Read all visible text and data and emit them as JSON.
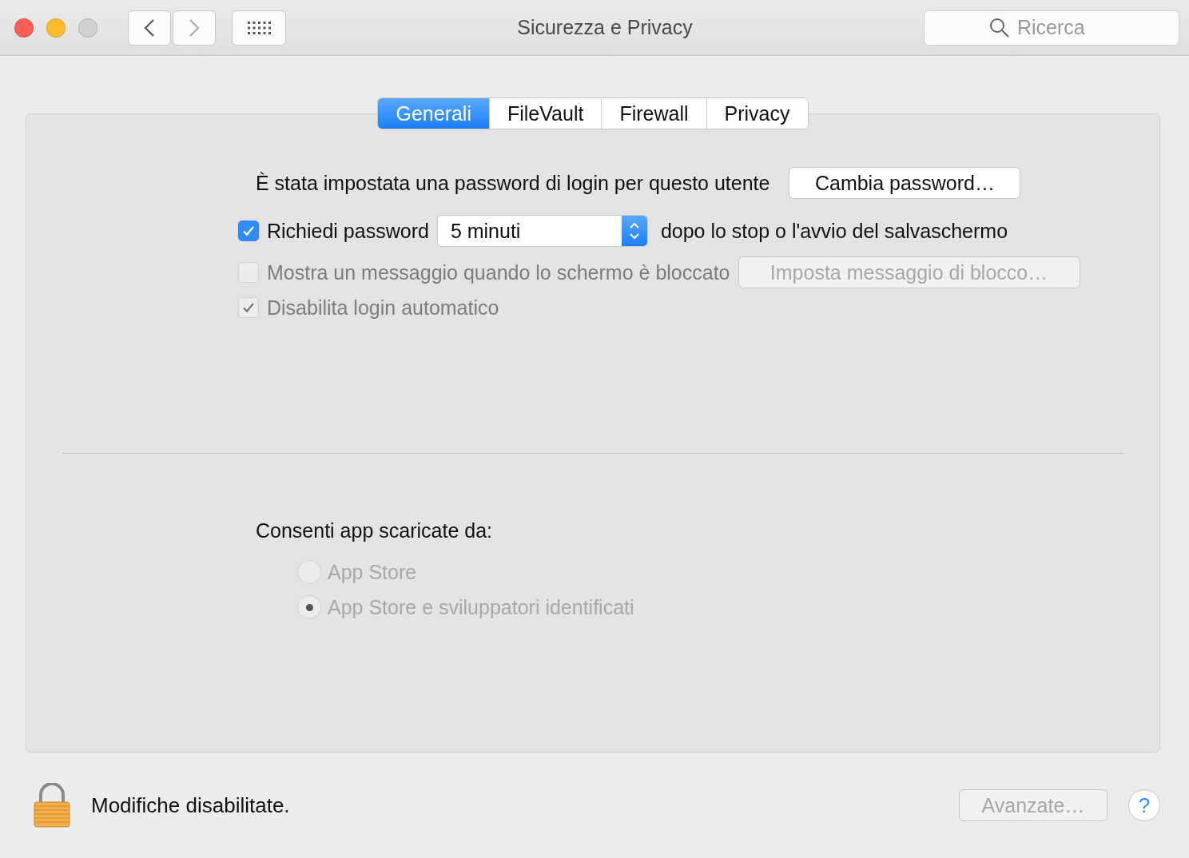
{
  "window": {
    "title": "Sicurezza e Privacy",
    "search": {
      "placeholder": "Ricerca"
    }
  },
  "tabs": [
    {
      "label": "Generali",
      "selected": true
    },
    {
      "label": "FileVault",
      "selected": false
    },
    {
      "label": "Firewall",
      "selected": false
    },
    {
      "label": "Privacy",
      "selected": false
    }
  ],
  "password_row": {
    "text": "È stata impostata una password di login per questo utente",
    "button": "Cambia password…"
  },
  "options": [
    {
      "kind": "select",
      "label": "Richiedi password",
      "checked": true,
      "disabled": false,
      "select_value": "5 minuti",
      "suffix": "dopo lo stop o l'avvio del salvaschermo"
    },
    {
      "kind": "button",
      "label": "Mostra un messaggio quando lo schermo è bloccato",
      "checked": false,
      "disabled": true,
      "button": "Imposta messaggio di blocco…"
    },
    {
      "kind": "plain",
      "label": "Disabilita login automatico",
      "checked": true,
      "disabled": true
    }
  ],
  "downloads": {
    "title": "Consenti app scaricate da:",
    "options": [
      {
        "label": "App Store",
        "selected": false,
        "disabled": true
      },
      {
        "label": "App Store e sviluppatori identificati",
        "selected": true,
        "disabled": true
      }
    ]
  },
  "footer": {
    "lock_text": "Modifiche disabilitate.",
    "advanced_button": "Avanzate…",
    "advanced_disabled": true,
    "help": "?"
  }
}
